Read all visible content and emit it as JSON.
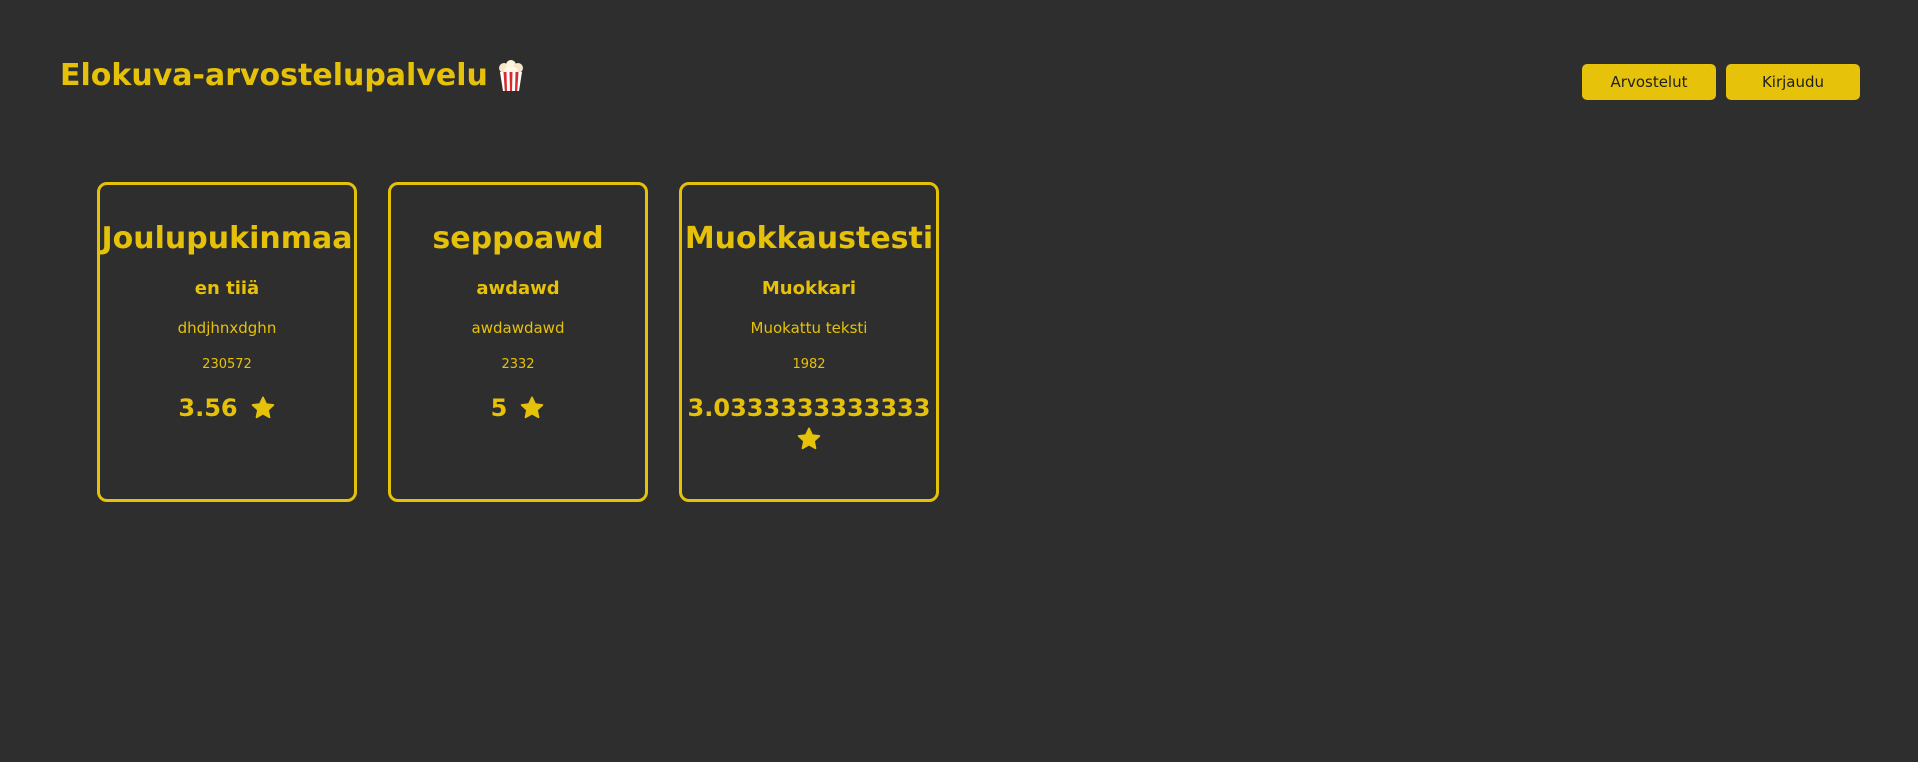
{
  "header": {
    "title": "Elokuva-arvostelupalvelu",
    "title_icon": "popcorn-icon",
    "nav": [
      {
        "label": "Arvostelut"
      },
      {
        "label": "Kirjaudu"
      }
    ]
  },
  "colors": {
    "background": "#2e2e2e",
    "accent": "#e6c10a",
    "button_text": "#1f1f1f"
  },
  "reviews": [
    {
      "title": "Joulupukinmaa",
      "subtitle": "en tiiä",
      "text": "dhdjhnxdghn",
      "year": "230572",
      "rating": "3.56",
      "rating_icon": "star-icon"
    },
    {
      "title": "seppoawd",
      "subtitle": "awdawd",
      "text": "awdawdawd",
      "year": "2332",
      "rating": "5",
      "rating_icon": "star-icon"
    },
    {
      "title": "Muokkaustesti",
      "subtitle": "Muokkari",
      "text": "Muokattu teksti",
      "year": "1982",
      "rating": "3.0333333333333",
      "rating_icon": "star-icon"
    }
  ]
}
